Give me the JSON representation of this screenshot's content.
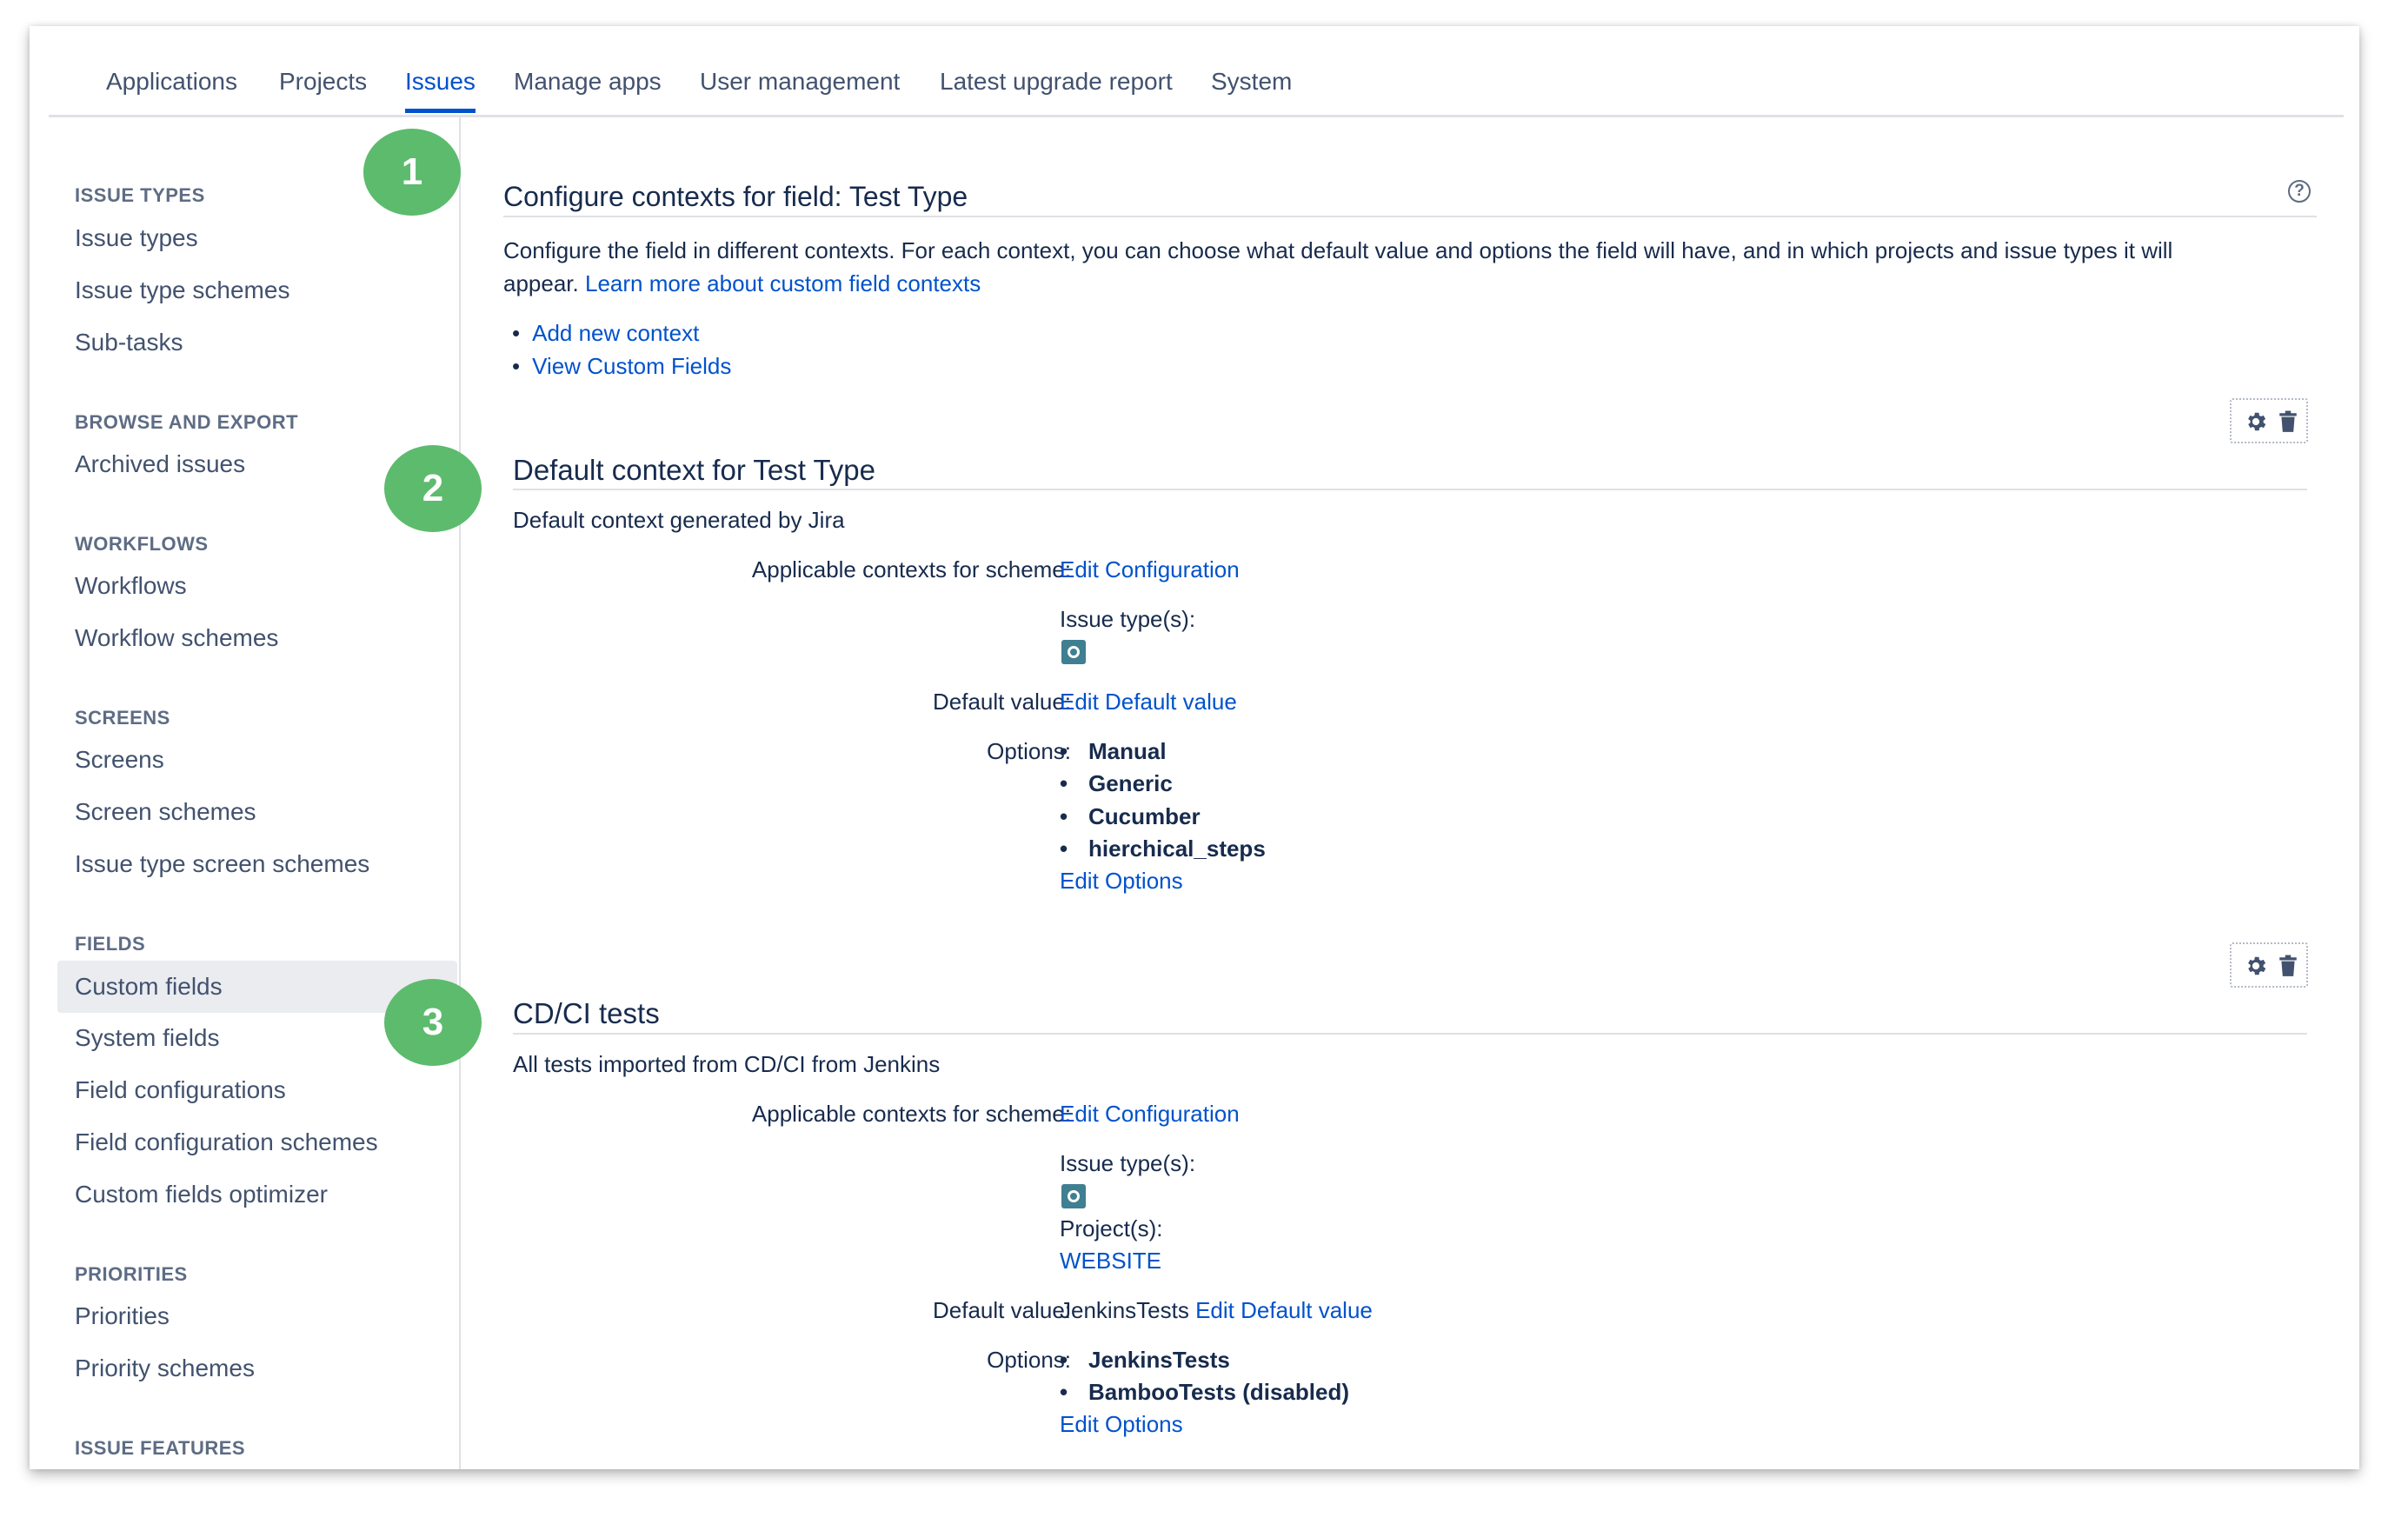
{
  "nav": {
    "tabs": [
      {
        "label": "Applications"
      },
      {
        "label": "Projects"
      },
      {
        "label": "Issues"
      },
      {
        "label": "Manage apps"
      },
      {
        "label": "User management"
      },
      {
        "label": "Latest upgrade report"
      },
      {
        "label": "System"
      }
    ],
    "active_tab": "Issues"
  },
  "sidebar": {
    "sections": [
      {
        "title": "ISSUE TYPES",
        "items": [
          "Issue types",
          "Issue type schemes",
          "Sub-tasks"
        ]
      },
      {
        "title": "BROWSE AND EXPORT",
        "items": [
          "Archived issues"
        ]
      },
      {
        "title": "WORKFLOWS",
        "items": [
          "Workflows",
          "Workflow schemes"
        ]
      },
      {
        "title": "SCREENS",
        "items": [
          "Screens",
          "Screen schemes",
          "Issue type screen schemes"
        ]
      },
      {
        "title": "FIELDS",
        "items": [
          "Custom fields",
          "System fields",
          "Field configurations",
          "Field configuration schemes",
          "Custom fields optimizer"
        ]
      },
      {
        "title": "PRIORITIES",
        "items": [
          "Priorities",
          "Priority schemes"
        ]
      },
      {
        "title": "ISSUE FEATURES",
        "items": []
      }
    ],
    "selected_item": "Custom fields"
  },
  "badges": [
    "1",
    "2",
    "3"
  ],
  "page": {
    "title": "Configure contexts for field: Test Type",
    "help_glyph": "?",
    "description_line1": "Configure the field in different contexts. For each context, you can choose what default value and options the field will have, and in which projects and issue types it will",
    "description_line2": "appear.",
    "learn_more": "Learn more about custom field contexts",
    "actions": [
      "Add new context",
      "View Custom Fields"
    ]
  },
  "labels": {
    "applicable": "Applicable contexts for scheme:",
    "issue_types": "Issue type(s):",
    "projects": "Project(s):",
    "default_value": "Default value:",
    "options": "Options:",
    "edit_configuration": "Edit Configuration",
    "edit_default": "Edit Default value",
    "edit_options": "Edit Options"
  },
  "contexts": [
    {
      "title": "Default context for Test Type",
      "description": "Default context generated by Jira",
      "default_value": "",
      "options": [
        "Manual",
        "Generic",
        "Cucumber",
        "hierchical_steps"
      ]
    },
    {
      "title": "CD/CI tests",
      "description": "All tests imported from CD/CI from Jenkins",
      "project": "WEBSITE",
      "default_value": "JenkinsTests",
      "options": [
        "JenkinsTests",
        "BambooTests (disabled)"
      ]
    }
  ],
  "icons": {
    "issue_type": "test-issue-type-icon",
    "configure": "gear-icon",
    "delete": "trash-icon",
    "help": "help-icon"
  },
  "colors": {
    "link": "#0052cc",
    "badge": "#5dbb6d",
    "issue_icon": "#3f7f91",
    "text": "#172b4d"
  }
}
